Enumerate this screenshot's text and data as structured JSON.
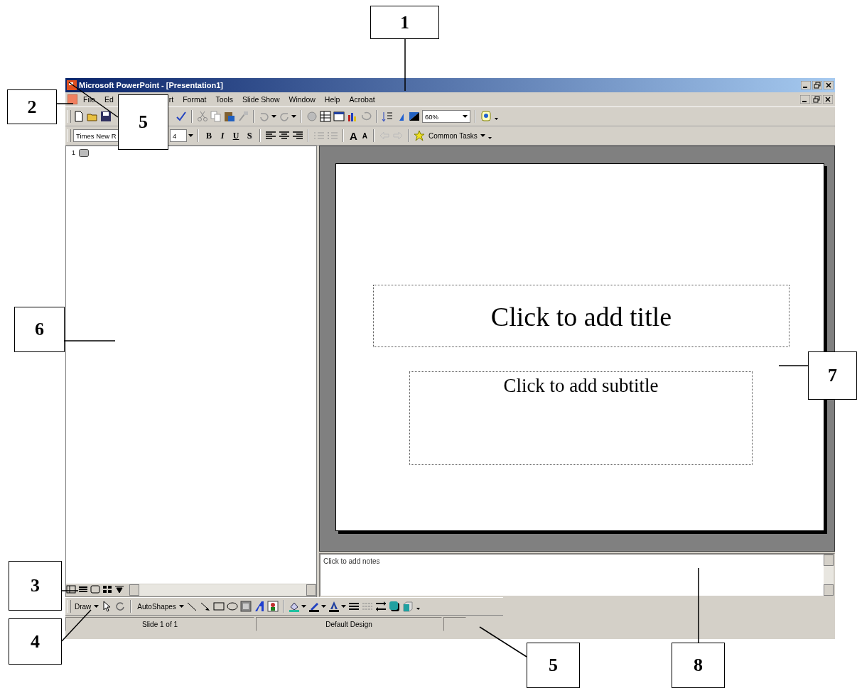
{
  "window": {
    "title": "Microsoft PowerPoint - [Presentation1]"
  },
  "menu": [
    {
      "label": "File"
    },
    {
      "label": "Ed"
    },
    {
      "label": "rt"
    },
    {
      "label": "Format"
    },
    {
      "label": "Tools"
    },
    {
      "label": "Slide Show"
    },
    {
      "label": "Window"
    },
    {
      "label": "Help"
    },
    {
      "label": "Acrobat"
    }
  ],
  "standard_toolbar": {
    "zoom": "60%"
  },
  "formatting_toolbar": {
    "font": "Times New R",
    "font_size": "4",
    "common_tasks": "Common Tasks"
  },
  "style_buttons": [
    {
      "label": "B",
      "kind": "bold"
    },
    {
      "label": "I",
      "kind": "italic"
    },
    {
      "label": "U",
      "kind": "underline"
    },
    {
      "label": "S",
      "kind": "shadow"
    }
  ],
  "font_size_buttons": [
    {
      "label": "A",
      "kind": "grow"
    },
    {
      "label": "A",
      "kind": "shrink"
    }
  ],
  "outline": {
    "slide_number": "1"
  },
  "slide": {
    "title_placeholder": "Click to add title",
    "subtitle_placeholder": "Click to add subtitle"
  },
  "notes": {
    "text": "Click to add notes"
  },
  "drawing_toolbar": {
    "draw": "Draw",
    "autoshapes": "AutoShapes"
  },
  "status_bar": {
    "slide": "Slide 1 of 1",
    "design": "Default Design"
  },
  "callouts": [
    {
      "label": "1"
    },
    {
      "label": "2"
    },
    {
      "label": "5"
    },
    {
      "label": "6"
    },
    {
      "label": "7"
    },
    {
      "label": "3"
    },
    {
      "label": "4"
    },
    {
      "label": "5"
    },
    {
      "label": "8"
    }
  ]
}
